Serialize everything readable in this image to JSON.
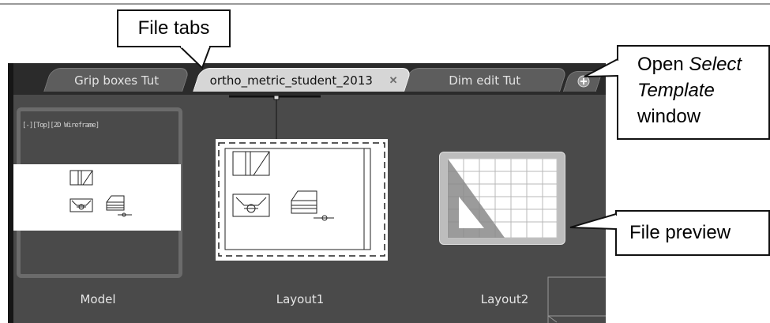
{
  "callouts": {
    "file_tabs": "File tabs",
    "open_select_template": {
      "line1": "Open",
      "line2_italic": "Select",
      "line3_italic": "Template",
      "line4": "window"
    },
    "file_preview": "File preview"
  },
  "tabs": [
    {
      "label": "Grip boxes Tut",
      "active": false
    },
    {
      "label": "ortho_metric_student_2013",
      "active": true,
      "close_icon": "close-icon"
    },
    {
      "label": "Dim edit Tut",
      "active": false
    }
  ],
  "new_tab_icon": "plus-circle-icon",
  "previews": [
    {
      "label": "Model",
      "viewport_caption": "[-][Top][2D Wireframe]"
    },
    {
      "label": "Layout1"
    },
    {
      "label": "Layout2",
      "icon": "template-grid-triangle-icon"
    }
  ],
  "colors": {
    "app_background": "#4a4a4a",
    "tab_active": "#d6d6d6",
    "tab_inactive": "#5d5d5d"
  }
}
